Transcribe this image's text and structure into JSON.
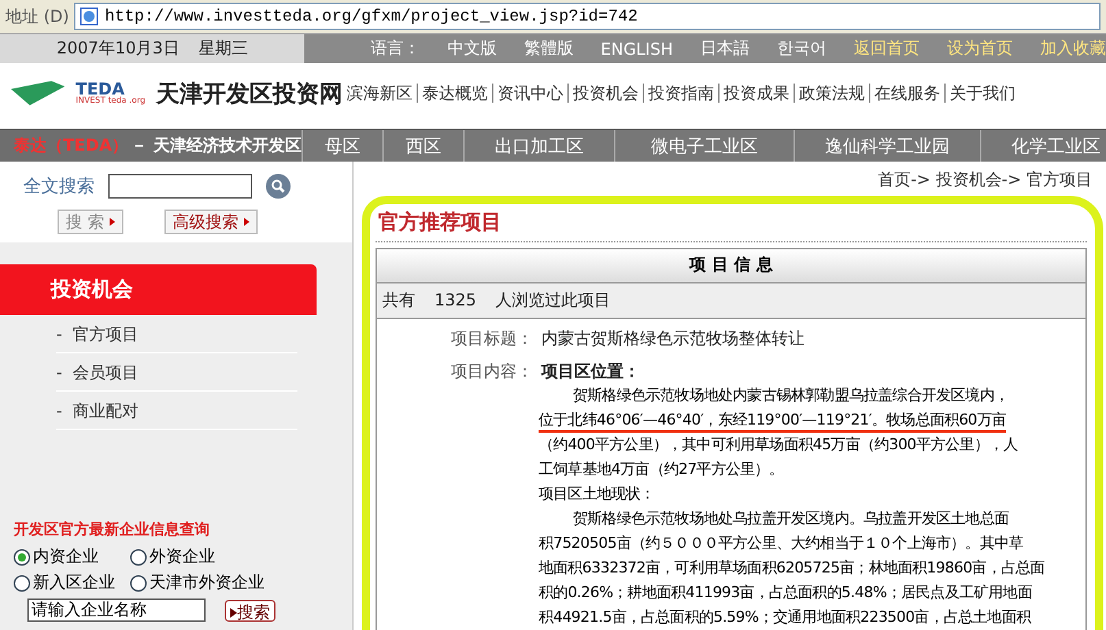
{
  "address_bar": {
    "label": "地址",
    "shortcut": "(D)",
    "url": "http://www.investteda.org/gfxm/project_view.jsp?id=742"
  },
  "top_bar": {
    "date": "2007年10月3日",
    "weekday": "星期三",
    "language_label": "语言：",
    "languages": [
      "中文版",
      "繁體版",
      "ENGLISH",
      "日本語",
      "한국어"
    ],
    "links": [
      "返回首页",
      "设为首页",
      "加入收藏"
    ]
  },
  "logo": {
    "brand": "TEDA",
    "sub": "INVEST teda .org",
    "site_name": "天津开发区投资网"
  },
  "main_nav": [
    "滨海新区",
    "泰达概览",
    "资讯中心",
    "投资机会",
    "投资指南",
    "投资成果",
    "政策法规",
    "在线服务",
    "关于我们"
  ],
  "zone_bar": {
    "brand": "泰达（TEDA）",
    "title": "－ 天津经济技术开发区",
    "zones": [
      "母区",
      "西区",
      "出口加工区",
      "微电子工业区",
      "逸仙科学工业园",
      "化学工业区"
    ]
  },
  "sidebar": {
    "search_label": "全文搜索",
    "search_buttons": [
      "搜 索",
      "高级搜索"
    ],
    "menu_heading": "投资机会",
    "menu_bullet": "-",
    "menu_items": [
      "官方项目",
      "会员项目",
      "商业配对"
    ],
    "query": {
      "title": "开发区官方最新企业信息查询",
      "radios": [
        {
          "label": "内资企业",
          "selected": true
        },
        {
          "label": "外资企业",
          "selected": false
        },
        {
          "label": "新入区企业",
          "selected": false
        },
        {
          "label": "天津市外资企业",
          "selected": false
        }
      ],
      "input_value": "请输入企业名称",
      "button": "搜索"
    }
  },
  "main": {
    "breadcrumb": "首页-> 投资机会-> 官方项目",
    "section_title": "官方推荐项目",
    "table_header": "项 目 信 息",
    "views": {
      "prefix": "共有",
      "count": "1325",
      "suffix": "人浏览过此项目"
    },
    "title_label": "项目标题：",
    "title_value": "内蒙古贺斯格绿色示范牧场整体转让",
    "content_label": "项目内容：",
    "content_heading": "项目区位置：",
    "lines": [
      {
        "text": "贺斯格绿色示范牧场地处内蒙古锡林郭勒盟乌拉盖综合开发区境内，",
        "indent": true,
        "underlined": false
      },
      {
        "text": "位于北纬46°06′—46°40′，东经119°00′—119°21′。牧场总面积60万亩",
        "indent": false,
        "underlined": true
      },
      {
        "text": "（约400平方公里），其中可利用草场面积45万亩（约300平方公里），人",
        "indent": false,
        "underlined": false
      },
      {
        "text": "工饲草基地4万亩（约27平方公里）。",
        "indent": false,
        "underlined": false
      },
      {
        "text": "项目区土地现状：",
        "indent": false,
        "underlined": false
      },
      {
        "text": "贺斯格绿色示范牧场地处乌拉盖开发区境内。乌拉盖开发区土地总面",
        "indent": true,
        "underlined": false
      },
      {
        "text": "积7520505亩（约５０００平方公里、大约相当于１０个上海市）。其中草",
        "indent": false,
        "underlined": false
      },
      {
        "text": "地面积6332372亩，可利用草场面积6205725亩；林地面积19860亩，占总面",
        "indent": false,
        "underlined": false
      },
      {
        "text": "积的0.26%；耕地面积411993亩，占总面积的5.48%；居民点及工矿用地面",
        "indent": false,
        "underlined": false
      },
      {
        "text": "积44921.5亩，占总面积的5.59%；交通用地面积223500亩，占总土地面积",
        "indent": false,
        "underlined": false
      }
    ]
  }
}
